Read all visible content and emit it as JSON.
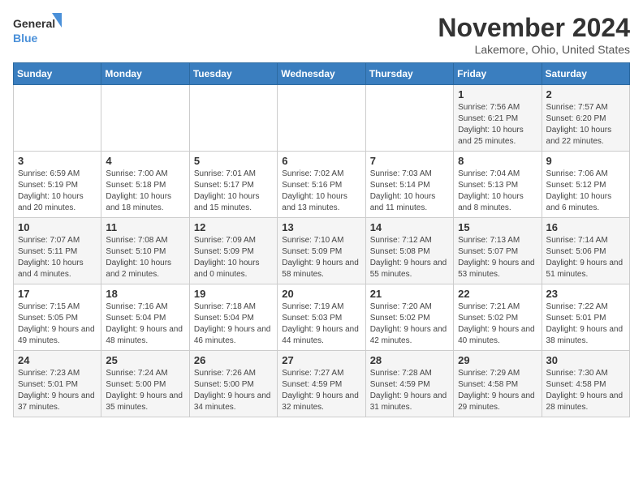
{
  "header": {
    "logo_general": "General",
    "logo_blue": "Blue",
    "title": "November 2024",
    "subtitle": "Lakemore, Ohio, United States"
  },
  "weekdays": [
    "Sunday",
    "Monday",
    "Tuesday",
    "Wednesday",
    "Thursday",
    "Friday",
    "Saturday"
  ],
  "weeks": [
    [
      {
        "day": "",
        "info": ""
      },
      {
        "day": "",
        "info": ""
      },
      {
        "day": "",
        "info": ""
      },
      {
        "day": "",
        "info": ""
      },
      {
        "day": "",
        "info": ""
      },
      {
        "day": "1",
        "info": "Sunrise: 7:56 AM\nSunset: 6:21 PM\nDaylight: 10 hours and 25 minutes."
      },
      {
        "day": "2",
        "info": "Sunrise: 7:57 AM\nSunset: 6:20 PM\nDaylight: 10 hours and 22 minutes."
      }
    ],
    [
      {
        "day": "3",
        "info": "Sunrise: 6:59 AM\nSunset: 5:19 PM\nDaylight: 10 hours and 20 minutes."
      },
      {
        "day": "4",
        "info": "Sunrise: 7:00 AM\nSunset: 5:18 PM\nDaylight: 10 hours and 18 minutes."
      },
      {
        "day": "5",
        "info": "Sunrise: 7:01 AM\nSunset: 5:17 PM\nDaylight: 10 hours and 15 minutes."
      },
      {
        "day": "6",
        "info": "Sunrise: 7:02 AM\nSunset: 5:16 PM\nDaylight: 10 hours and 13 minutes."
      },
      {
        "day": "7",
        "info": "Sunrise: 7:03 AM\nSunset: 5:14 PM\nDaylight: 10 hours and 11 minutes."
      },
      {
        "day": "8",
        "info": "Sunrise: 7:04 AM\nSunset: 5:13 PM\nDaylight: 10 hours and 8 minutes."
      },
      {
        "day": "9",
        "info": "Sunrise: 7:06 AM\nSunset: 5:12 PM\nDaylight: 10 hours and 6 minutes."
      }
    ],
    [
      {
        "day": "10",
        "info": "Sunrise: 7:07 AM\nSunset: 5:11 PM\nDaylight: 10 hours and 4 minutes."
      },
      {
        "day": "11",
        "info": "Sunrise: 7:08 AM\nSunset: 5:10 PM\nDaylight: 10 hours and 2 minutes."
      },
      {
        "day": "12",
        "info": "Sunrise: 7:09 AM\nSunset: 5:09 PM\nDaylight: 10 hours and 0 minutes."
      },
      {
        "day": "13",
        "info": "Sunrise: 7:10 AM\nSunset: 5:09 PM\nDaylight: 9 hours and 58 minutes."
      },
      {
        "day": "14",
        "info": "Sunrise: 7:12 AM\nSunset: 5:08 PM\nDaylight: 9 hours and 55 minutes."
      },
      {
        "day": "15",
        "info": "Sunrise: 7:13 AM\nSunset: 5:07 PM\nDaylight: 9 hours and 53 minutes."
      },
      {
        "day": "16",
        "info": "Sunrise: 7:14 AM\nSunset: 5:06 PM\nDaylight: 9 hours and 51 minutes."
      }
    ],
    [
      {
        "day": "17",
        "info": "Sunrise: 7:15 AM\nSunset: 5:05 PM\nDaylight: 9 hours and 49 minutes."
      },
      {
        "day": "18",
        "info": "Sunrise: 7:16 AM\nSunset: 5:04 PM\nDaylight: 9 hours and 48 minutes."
      },
      {
        "day": "19",
        "info": "Sunrise: 7:18 AM\nSunset: 5:04 PM\nDaylight: 9 hours and 46 minutes."
      },
      {
        "day": "20",
        "info": "Sunrise: 7:19 AM\nSunset: 5:03 PM\nDaylight: 9 hours and 44 minutes."
      },
      {
        "day": "21",
        "info": "Sunrise: 7:20 AM\nSunset: 5:02 PM\nDaylight: 9 hours and 42 minutes."
      },
      {
        "day": "22",
        "info": "Sunrise: 7:21 AM\nSunset: 5:02 PM\nDaylight: 9 hours and 40 minutes."
      },
      {
        "day": "23",
        "info": "Sunrise: 7:22 AM\nSunset: 5:01 PM\nDaylight: 9 hours and 38 minutes."
      }
    ],
    [
      {
        "day": "24",
        "info": "Sunrise: 7:23 AM\nSunset: 5:01 PM\nDaylight: 9 hours and 37 minutes."
      },
      {
        "day": "25",
        "info": "Sunrise: 7:24 AM\nSunset: 5:00 PM\nDaylight: 9 hours and 35 minutes."
      },
      {
        "day": "26",
        "info": "Sunrise: 7:26 AM\nSunset: 5:00 PM\nDaylight: 9 hours and 34 minutes."
      },
      {
        "day": "27",
        "info": "Sunrise: 7:27 AM\nSunset: 4:59 PM\nDaylight: 9 hours and 32 minutes."
      },
      {
        "day": "28",
        "info": "Sunrise: 7:28 AM\nSunset: 4:59 PM\nDaylight: 9 hours and 31 minutes."
      },
      {
        "day": "29",
        "info": "Sunrise: 7:29 AM\nSunset: 4:58 PM\nDaylight: 9 hours and 29 minutes."
      },
      {
        "day": "30",
        "info": "Sunrise: 7:30 AM\nSunset: 4:58 PM\nDaylight: 9 hours and 28 minutes."
      }
    ]
  ]
}
